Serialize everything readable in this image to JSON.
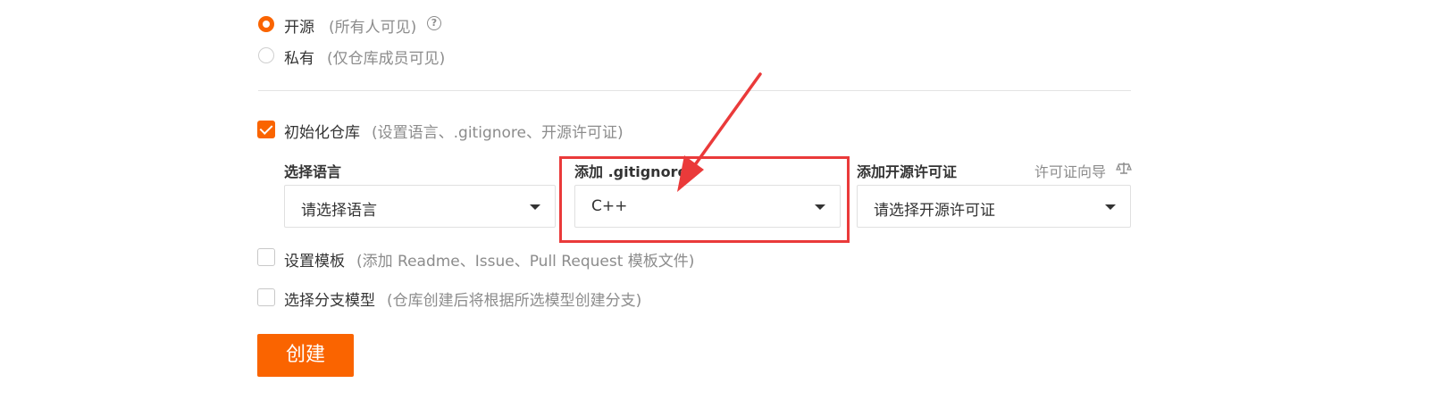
{
  "visibility": {
    "public": {
      "label": "开源",
      "hint": "(所有人可见)",
      "help_glyph": "?",
      "checked": true
    },
    "private": {
      "label": "私有",
      "hint": "(仅仓库成员可见)",
      "checked": false
    }
  },
  "init_repo": {
    "label": "初始化仓库",
    "hint": "(设置语言、.gitignore、开源许可证)",
    "checked": true
  },
  "fields": {
    "language": {
      "title": "选择语言",
      "value": "请选择语言"
    },
    "gitignore": {
      "title": "添加 .gitignore",
      "value": "C++"
    },
    "license": {
      "title": "添加开源许可证",
      "value": "请选择开源许可证",
      "guide": "许可证向导",
      "guide_icon": "scale-icon"
    }
  },
  "template": {
    "label": "设置模板",
    "hint": "(添加 Readme、Issue、Pull Request 模板文件)",
    "checked": false
  },
  "branch_model": {
    "label": "选择分支模型",
    "hint": "(仓库创建后将根据所选模型创建分支)",
    "checked": false
  },
  "create_button": {
    "label": "创建"
  },
  "colors": {
    "accent": "#fa6400",
    "annotation": "#ea3a3a"
  }
}
